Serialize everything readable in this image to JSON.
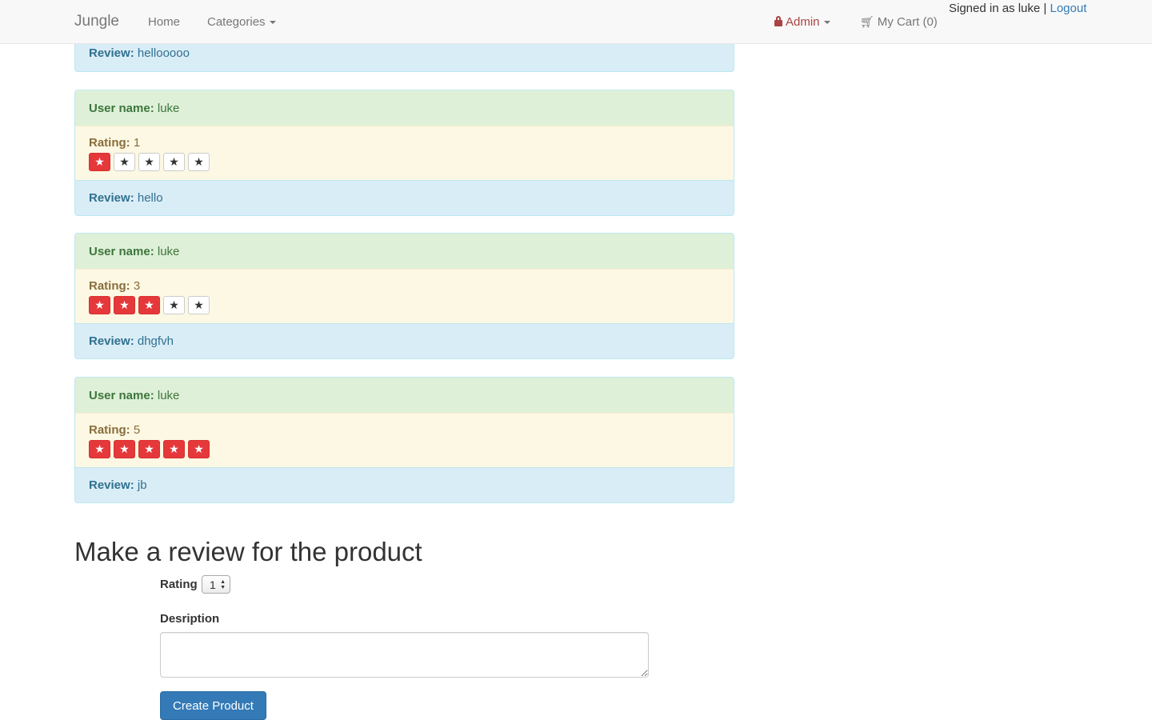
{
  "navbar": {
    "brand": "Jungle",
    "home": "Home",
    "categories": "Categories",
    "admin": "Admin",
    "cart": "My Cart (0)",
    "signed_in": "Signed in as luke |",
    "logout": "Logout"
  },
  "partial_review": {
    "label": "Review:",
    "text": "hellooooo"
  },
  "labels": {
    "user": "User name:",
    "rating": "Rating:",
    "review": "Review:"
  },
  "reviews": [
    {
      "user": "luke",
      "rating": "1",
      "rating_value": 1,
      "review": "hello"
    },
    {
      "user": "luke",
      "rating": "3",
      "rating_value": 3,
      "review": "dhgfvh"
    },
    {
      "user": "luke",
      "rating": "5",
      "rating_value": 5,
      "review": "jb"
    }
  ],
  "star_max": 5,
  "star_glyph": "★",
  "form": {
    "title": "Make a review for the product",
    "rating_label": "Rating",
    "rating_value": "1",
    "description_label": "Desription",
    "description_value": "",
    "submit_label": "Create Product"
  }
}
